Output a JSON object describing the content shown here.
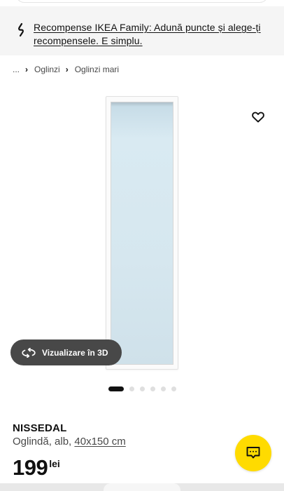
{
  "promo": {
    "text": "Recompense IKEA Family: Adună puncte și alege-ți recompensele. E simplu.",
    "icon": "link-chain-icon"
  },
  "breadcrumb": {
    "ellipsis": "...",
    "items": [
      "Oglinzi",
      "Oglinzi mari"
    ]
  },
  "gallery": {
    "view_3d_label": "Vizualizare în 3D",
    "slide_count": 6,
    "active_slide": 1
  },
  "product": {
    "name": "NISSEDAL",
    "description": "Oglindă, alb, ",
    "size": "40x150 cm",
    "price": "199",
    "currency": "lei"
  },
  "colors": {
    "chat_button": "#ffdb00",
    "view_3d_button": "#484848",
    "promo_background": "#f5f5f5"
  }
}
